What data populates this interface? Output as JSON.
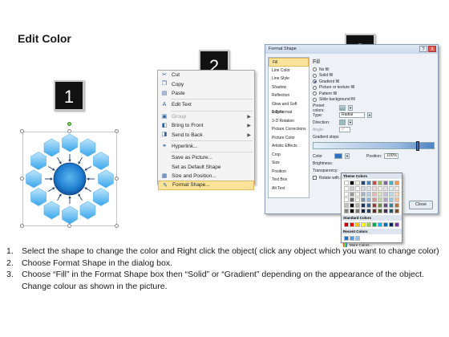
{
  "title": "Edit Color",
  "steps": [
    "1",
    "2",
    "3"
  ],
  "context_menu": {
    "items": [
      {
        "label": "Cut",
        "icon": "scissors-icon",
        "glyph": "✂",
        "disabled": false
      },
      {
        "label": "Copy",
        "icon": "copy-icon",
        "glyph": "❐",
        "disabled": false
      },
      {
        "label": "Paste",
        "icon": "paste-icon",
        "glyph": "▤",
        "disabled": false
      },
      {
        "label": "Edit Text",
        "icon": "edit-text-icon",
        "glyph": "A",
        "disabled": false
      },
      {
        "label": "Group",
        "icon": "group-icon",
        "glyph": "▣",
        "disabled": true,
        "submenu": true
      },
      {
        "label": "Bring to Front",
        "icon": "bring-front-icon",
        "glyph": "◧",
        "disabled": false,
        "submenu": true
      },
      {
        "label": "Send to Back",
        "icon": "send-back-icon",
        "glyph": "◨",
        "disabled": false,
        "submenu": true
      },
      {
        "label": "Hyperlink...",
        "icon": "hyperlink-icon",
        "glyph": "⚭",
        "disabled": false
      },
      {
        "label": "Save as Picture...",
        "icon": "",
        "glyph": "",
        "disabled": false
      },
      {
        "label": "Set as Default Shape",
        "icon": "",
        "glyph": "",
        "disabled": false
      },
      {
        "label": "Size and Position...",
        "icon": "size-icon",
        "glyph": "▦",
        "disabled": false
      },
      {
        "label": "Format Shape...",
        "icon": "format-shape-icon",
        "glyph": "✎",
        "disabled": false,
        "highlighted": true
      }
    ]
  },
  "dialog": {
    "title": "Format Shape",
    "title_buttons": [
      "?",
      "X"
    ],
    "categories": [
      "Fill",
      "Line Color",
      "Line Style",
      "Shadow",
      "Reflection",
      "Glow and Soft Edges",
      "3-D Format",
      "3-D Rotation",
      "Picture Corrections",
      "Picture Color",
      "Artistic Effects",
      "Crop",
      "Size",
      "Position",
      "Text Box",
      "Alt Text"
    ],
    "selected_category": "Fill",
    "section_title": "Fill",
    "fill_options": [
      "No fill",
      "Solid fill",
      "Gradient fill",
      "Picture or texture fill",
      "Pattern fill",
      "Slide background fill"
    ],
    "selected_fill": "Gradient fill",
    "preset_colors_label": "Preset colors:",
    "type_label": "Type:",
    "type_value": "Radial",
    "direction_label": "Direction:",
    "angle_label": "Angle:",
    "angle_value": "0°",
    "gradient_stops_label": "Gradient stops",
    "color_label": "Color",
    "position_label": "Position:",
    "position_value": "100%",
    "brightness_label": "Brightness:",
    "transparency_label": "Transparency:",
    "rotate_label": "Rotate with shape",
    "close_label": "Close"
  },
  "color_popup": {
    "theme_header": "Theme Colors",
    "standard_header": "Standard Colors",
    "recent_header": "Recent Colors",
    "more_colors": "More Colors...",
    "theme_top": [
      "#ffffff",
      "#000000",
      "#eeece1",
      "#1f497d",
      "#4f81bd",
      "#c0504d",
      "#9bbb59",
      "#8064a2",
      "#4bacc6",
      "#f79646"
    ],
    "standard": [
      "#c00000",
      "#ff0000",
      "#ffc000",
      "#ffff00",
      "#92d050",
      "#00b050",
      "#00b0f0",
      "#0070c0",
      "#002060",
      "#7030a0"
    ],
    "recent": [
      "#1f6fc7",
      "#4f9ae6",
      "#8cc3f2"
    ]
  },
  "instructions": [
    {
      "num": "1.",
      "text": "Select the shape to change the color and Right click the object( click any object which you want to change color)"
    },
    {
      "num": "2.",
      "text": "Choose Format Shape in the dialog box."
    },
    {
      "num": "3.",
      "text": "Choose “Fill” in the Format Shape box then “Solid” or “Gradient” depending on the appearance of the object. Change colour as shown in the picture."
    }
  ]
}
